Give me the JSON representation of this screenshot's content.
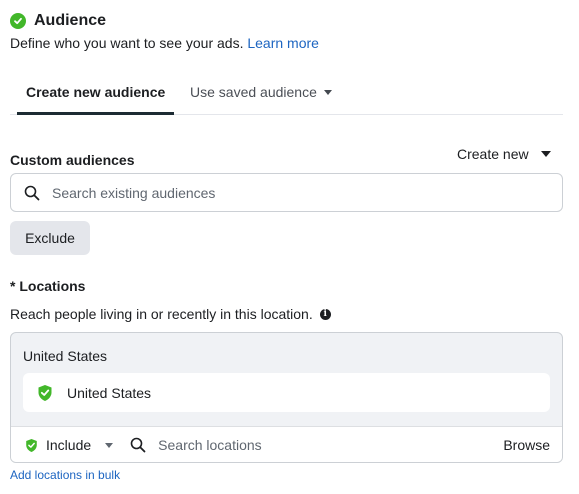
{
  "audience": {
    "title": "Audience",
    "description": "Define who you want to see your ads.",
    "learn_more": "Learn more",
    "status_icon": "green-check-circle",
    "status_color": "#42b72a"
  },
  "tabs": {
    "create_new": "Create new audience",
    "use_saved": "Use saved audience",
    "active": "create_new"
  },
  "custom_audiences": {
    "label": "Custom audiences",
    "create_new": "Create new",
    "search_placeholder": "Search existing audiences",
    "exclude_button": "Exclude"
  },
  "locations": {
    "label": "* Locations",
    "description": "Reach people living in or recently in this location.",
    "group_title": "United States",
    "selected": "United States",
    "include_label": "Include",
    "search_placeholder": "Search locations",
    "browse": "Browse",
    "add_bulk": "Add locations in bulk"
  },
  "colors": {
    "link": "#1d65c1",
    "accent_green": "#42b72a",
    "tab_underline": "#1c2b33",
    "panel_bg": "#f0f2f5",
    "button_bg": "#e4e6eb"
  }
}
